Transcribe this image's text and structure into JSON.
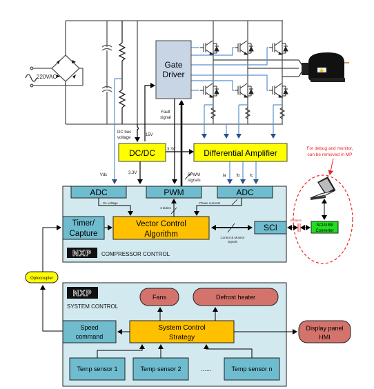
{
  "power_stage": {
    "ac_source": "220VAC",
    "gate_driver": {
      "line1": "Gate",
      "line2": "Driver"
    },
    "fault_signal": {
      "line1": "Fault",
      "line2": "signal"
    },
    "dc_bus_voltage": {
      "line1": "DC bus",
      "line2": "voltage"
    },
    "v15": "15V",
    "compressor": "compressor-motor"
  },
  "dcdc": {
    "label": "DC/DC",
    "out_3v3_right": "3.3V",
    "out_3v3_down": "3.3V"
  },
  "diff_amp": {
    "label": "Differential Amplifier",
    "outputs": [
      "Ia",
      "Ib",
      "Ic"
    ]
  },
  "signals": {
    "vdc": "Vdc",
    "pwm6": {
      "line1": "6PWM",
      "line2": "signals"
    },
    "dc_voltage": "Dc voltage",
    "three_duties": "3 duties",
    "phase_currents": "Phase currents",
    "ctrl_monitor": {
      "line1": "Control & Monitor",
      "line2": "signals"
    }
  },
  "compressor_control": {
    "title": "COMPRESSOR CONTROL",
    "logo": "NXP",
    "adc_left": "ADC",
    "pwm": "PWM",
    "adc_right": "ADC",
    "timer": {
      "line1": "Timer/",
      "line2": "Capture"
    },
    "vector": {
      "line1": "Vector Control",
      "line2": "Algorithm"
    },
    "sci": "SCI"
  },
  "debug": {
    "note": {
      "line1": "For debug and monitor,",
      "line2": "can be removed in MP"
    },
    "isolation": "Isolation",
    "converter": {
      "line1": "SCI/USB",
      "line2": "Converter"
    },
    "laptop": "laptop"
  },
  "optocoupler": "Optocoupler",
  "system_control": {
    "title": "SYSTEM CONTROL",
    "logo": "NXP",
    "fans": "Fans",
    "defrost": "Defrost heater",
    "speed": {
      "line1": "Speed",
      "line2": "command"
    },
    "strategy": {
      "line1": "System Control",
      "line2": "Strategy"
    },
    "sensors": [
      "Temp sensor 1",
      "Temp sensor 2",
      "Temp sensor n"
    ],
    "ellipsis": "......"
  },
  "display": {
    "line1": "Display panel",
    "line2": "HMI"
  },
  "colors": {
    "block_blue": "#6fbccf",
    "panel_bg": "#d3e9f0",
    "yellow": "#ffff00",
    "orange": "#ffc000",
    "red_pill": "#d4736c",
    "green": "#22dd22",
    "gate_driver": "#c7d5e4",
    "signal_blue": "#5b8fd1",
    "debug_red": "#ee2222"
  }
}
